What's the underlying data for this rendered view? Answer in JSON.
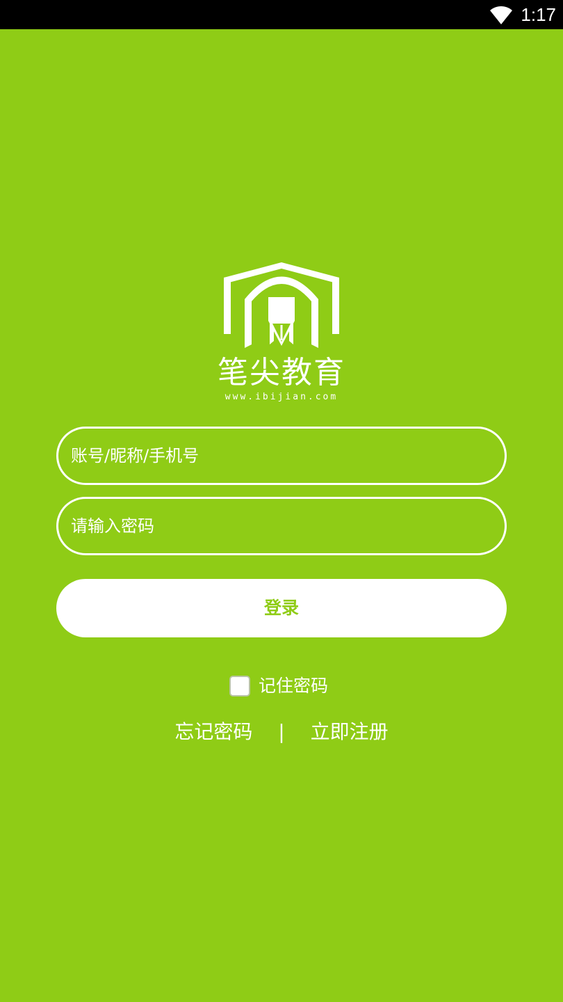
{
  "status_bar": {
    "time": "1:17",
    "wifi_icon": "wifi-icon"
  },
  "brand": {
    "logo_icon": "house-pen-logo-icon",
    "name": "笔尖教育",
    "url": "www.ibijian.com"
  },
  "form": {
    "account_placeholder": "账号/昵称/手机号",
    "account_value": "",
    "password_placeholder": "请输入密码",
    "password_value": "",
    "login_label": "登录",
    "remember_label": "记住密码",
    "remember_checked": false
  },
  "links": {
    "forgot_password": "忘记密码",
    "separator": "|",
    "register": "立即注册"
  },
  "colors": {
    "background": "#8fcc16",
    "status_bar": "#000000",
    "foreground": "#ffffff"
  }
}
